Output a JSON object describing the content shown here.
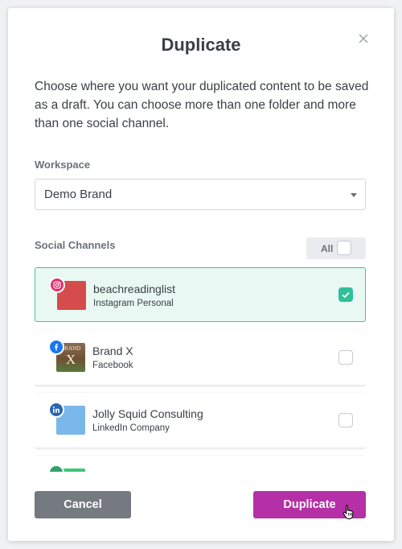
{
  "dialog": {
    "title": "Duplicate",
    "description": "Choose where you want your duplicated content to be saved as a draft. You can choose more than one folder and more than one social channel."
  },
  "workspace": {
    "label": "Workspace",
    "selected": "Demo Brand"
  },
  "social_channels": {
    "label": "Social Channels",
    "all_label": "All",
    "all_checked": false,
    "items": [
      {
        "name": "beachreadinglist",
        "type": "Instagram Personal",
        "network": "instagram-icon",
        "checked": true
      },
      {
        "name": "Brand X",
        "type": "Facebook",
        "network": "facebook-icon",
        "checked": false
      },
      {
        "name": "Jolly Squid Consulting",
        "type": "LinkedIn Company",
        "network": "linkedin-icon",
        "checked": false
      }
    ]
  },
  "buttons": {
    "cancel": "Cancel",
    "duplicate": "Duplicate"
  },
  "avatar_text": {
    "brand_x_top": "BRAND",
    "brand_x_letter": "X"
  },
  "colors": {
    "accent_purple": "#b52fa6",
    "selected_green": "#37c8a0",
    "instagram": "#e1306c",
    "facebook": "#1877f2",
    "linkedin": "#2867b2"
  }
}
